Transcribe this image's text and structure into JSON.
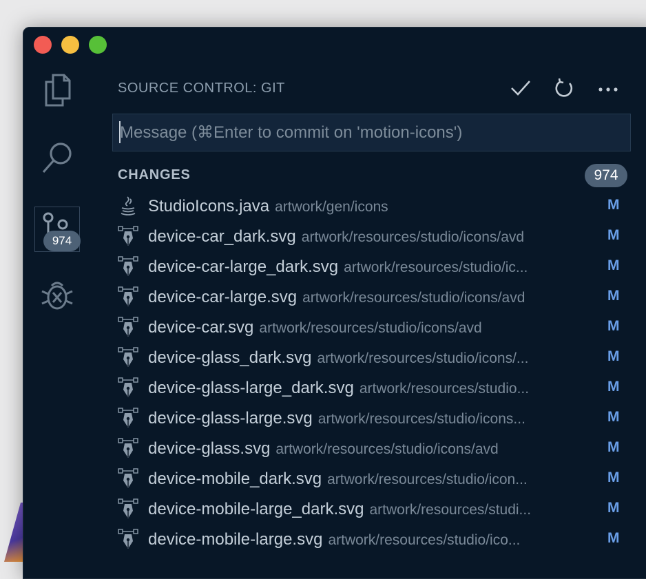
{
  "window": {
    "controls": [
      "close",
      "minimize",
      "zoom"
    ]
  },
  "activity_bar": {
    "items": [
      {
        "name": "explorer",
        "icon": "files-icon"
      },
      {
        "name": "search",
        "icon": "search-icon"
      },
      {
        "name": "source-control",
        "icon": "git-icon",
        "badge": "974",
        "active": true
      },
      {
        "name": "debug",
        "icon": "bug-icon"
      }
    ]
  },
  "panel": {
    "title": "SOURCE CONTROL: GIT",
    "actions": [
      "commit-check-icon",
      "refresh-icon",
      "more-icon"
    ],
    "commit_placeholder": "Message (⌘Enter to commit on 'motion-icons')",
    "commit_value": ""
  },
  "changes": {
    "title": "CHANGES",
    "count": "974",
    "files": [
      {
        "name": "StudioIcons.java",
        "path": "artwork/gen/icons",
        "status": "M",
        "icon": "java-icon"
      },
      {
        "name": "device-car_dark.svg",
        "path": "artwork/resources/studio/icons/avd",
        "status": "M",
        "icon": "svg-pen-icon"
      },
      {
        "name": "device-car-large_dark.svg",
        "path": "artwork/resources/studio/ic...",
        "status": "M",
        "icon": "svg-pen-icon"
      },
      {
        "name": "device-car-large.svg",
        "path": "artwork/resources/studio/icons/avd",
        "status": "M",
        "icon": "svg-pen-icon"
      },
      {
        "name": "device-car.svg",
        "path": "artwork/resources/studio/icons/avd",
        "status": "M",
        "icon": "svg-pen-icon"
      },
      {
        "name": "device-glass_dark.svg",
        "path": "artwork/resources/studio/icons/...",
        "status": "M",
        "icon": "svg-pen-icon"
      },
      {
        "name": "device-glass-large_dark.svg",
        "path": "artwork/resources/studio...",
        "status": "M",
        "icon": "svg-pen-icon"
      },
      {
        "name": "device-glass-large.svg",
        "path": "artwork/resources/studio/icons...",
        "status": "M",
        "icon": "svg-pen-icon"
      },
      {
        "name": "device-glass.svg",
        "path": "artwork/resources/studio/icons/avd",
        "status": "M",
        "icon": "svg-pen-icon"
      },
      {
        "name": "device-mobile_dark.svg",
        "path": "artwork/resources/studio/icon...",
        "status": "M",
        "icon": "svg-pen-icon"
      },
      {
        "name": "device-mobile-large_dark.svg",
        "path": "artwork/resources/studi...",
        "status": "M",
        "icon": "svg-pen-icon"
      },
      {
        "name": "device-mobile-large.svg",
        "path": "artwork/resources/studio/ico...",
        "status": "M",
        "icon": "svg-pen-icon"
      }
    ]
  },
  "colors": {
    "background": "#081727",
    "input_bg": "#13253a",
    "badge_bg": "#4d6176",
    "status_modified": "#6a9fe8"
  }
}
